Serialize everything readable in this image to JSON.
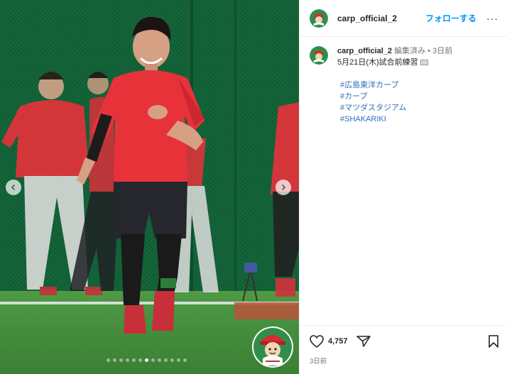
{
  "post": {
    "username": "carp_official_2",
    "follow_label": "フォローする",
    "more_label": "···"
  },
  "caption": {
    "username": "carp_official_2",
    "edited": "編集済み",
    "separator": "•",
    "time": "3日前",
    "text": "5月21日(木)試合前練習",
    "emoji_icon": "camera-icon",
    "hashtags": [
      "#広島東洋カープ",
      "#カープ",
      "#マツダスタジアム",
      "#SHAKARIKI"
    ]
  },
  "actions": {
    "like_count": "4,757",
    "timestamp": "3日前"
  },
  "carousel": {
    "slide_count": 13,
    "active_index": 6
  },
  "colors": {
    "follow": "#0095f6",
    "hashtag": "#2f6fb7",
    "uniform_red": "#e8323a",
    "net_green": "#1a6b3f",
    "turf_green": "#3f8a3a"
  }
}
